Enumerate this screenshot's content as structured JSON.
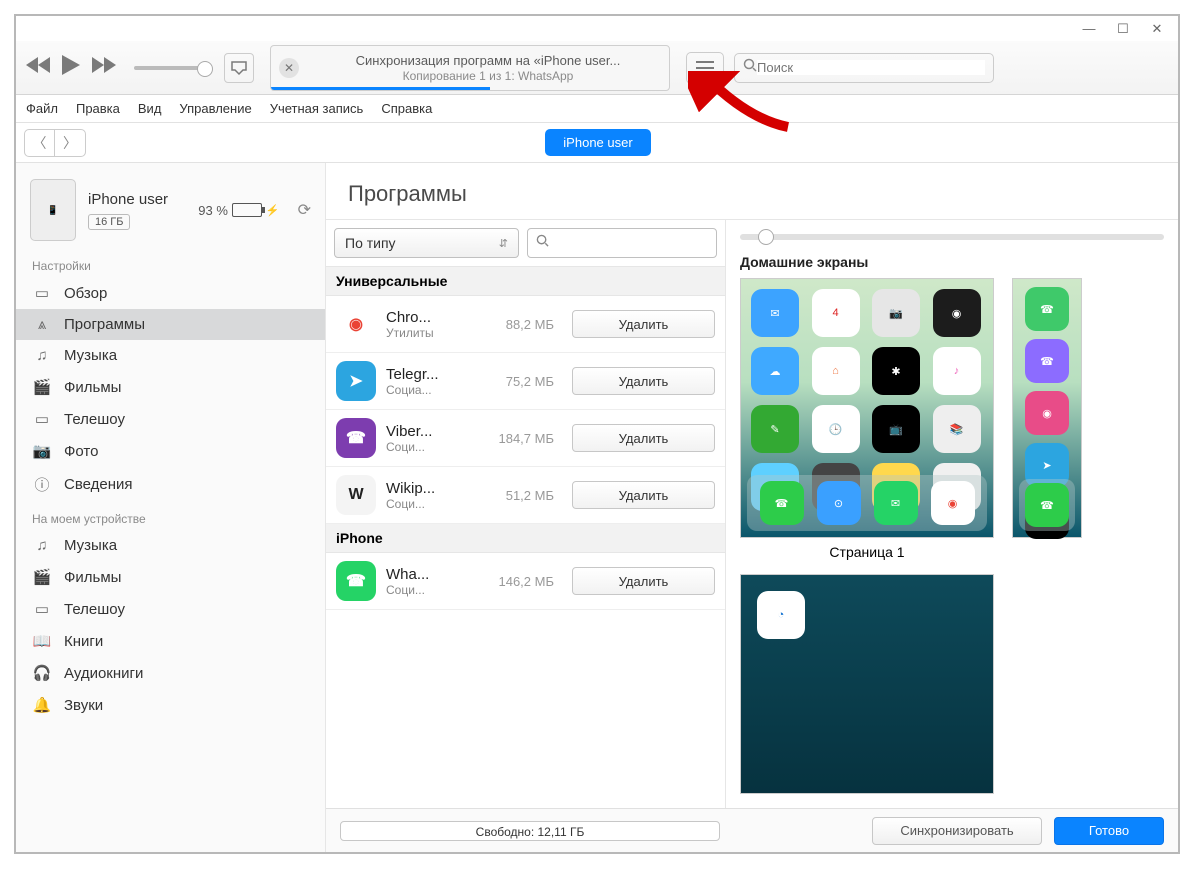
{
  "window": {
    "minimize": "—",
    "maximize": "☐",
    "close": "✕"
  },
  "player": {
    "status_title": "Синхронизация программ на «iPhone user...",
    "status_sub": "Копирование 1 из 1: WhatsApp",
    "search_placeholder": "Поиск"
  },
  "menus": [
    "Файл",
    "Правка",
    "Вид",
    "Управление",
    "Учетная запись",
    "Справка"
  ],
  "device_pill": "iPhone user",
  "device": {
    "name": "iPhone user",
    "capacity_label": "16 ГБ",
    "battery_pct": "93 %"
  },
  "sidebar": {
    "settings_header": "Настройки",
    "settings": [
      {
        "icon": "overview-icon",
        "glyph": "▭",
        "label": "Обзор"
      },
      {
        "icon": "apps-icon",
        "glyph": "⩓",
        "label": "Программы",
        "active": true
      },
      {
        "icon": "music-icon",
        "glyph": "♫",
        "label": "Музыка"
      },
      {
        "icon": "movies-icon",
        "glyph": "🎬",
        "label": "Фильмы"
      },
      {
        "icon": "tv-icon",
        "glyph": "▭",
        "label": "Телешоу"
      },
      {
        "icon": "photo-icon",
        "glyph": "📷",
        "label": "Фото"
      },
      {
        "icon": "info-icon",
        "glyph": "ⓘ",
        "label": "Сведения"
      }
    ],
    "device_header": "На моем устройстве",
    "device_items": [
      {
        "icon": "music-icon",
        "glyph": "♫",
        "label": "Музыка"
      },
      {
        "icon": "movies-icon",
        "glyph": "🎬",
        "label": "Фильмы"
      },
      {
        "icon": "tv-icon",
        "glyph": "▭",
        "label": "Телешоу"
      },
      {
        "icon": "books-icon",
        "glyph": "📖",
        "label": "Книги"
      },
      {
        "icon": "audiobooks-icon",
        "glyph": "🎧",
        "label": "Аудиокниги"
      },
      {
        "icon": "tones-icon",
        "glyph": "🔔",
        "label": "Звуки"
      }
    ]
  },
  "main": {
    "heading": "Программы",
    "sort_label": "По типу",
    "groups": [
      {
        "title": "Универсальные",
        "apps": [
          {
            "name": "Chro...",
            "cat": "Утилиты",
            "size": "88,2 МБ",
            "btn": "Удалить",
            "bg": "#fff",
            "glyph": "◉",
            "fg": "#ea4335"
          },
          {
            "name": "Telegr...",
            "cat": "Социа...",
            "size": "75,2 МБ",
            "btn": "Удалить",
            "bg": "#2ca5e0",
            "glyph": "➤"
          },
          {
            "name": "Viber...",
            "cat": "Соци...",
            "size": "184,7 МБ",
            "btn": "Удалить",
            "bg": "#7d3daf",
            "glyph": "☎"
          },
          {
            "name": "Wikip...",
            "cat": "Соци...",
            "size": "51,2 МБ",
            "btn": "Удалить",
            "bg": "#f4f4f4",
            "glyph": "W",
            "fg": "#222"
          }
        ]
      },
      {
        "title": "iPhone",
        "apps": [
          {
            "name": "Wha...",
            "cat": "Соци...",
            "size": "146,2 МБ",
            "btn": "Удалить",
            "bg": "#25d366",
            "glyph": "☎"
          }
        ]
      }
    ],
    "home_header": "Домашние экраны",
    "page1_label": "Страница 1",
    "home_icons_p1": [
      {
        "bg": "#3ca3ff",
        "g": "✉"
      },
      {
        "bg": "#fff",
        "g": "4",
        "fg": "#d22"
      },
      {
        "bg": "#e6e6e6",
        "g": "📷",
        "fg": "#555"
      },
      {
        "bg": "#1c1c1c",
        "g": "◉"
      },
      {
        "bg": "#3fa9ff",
        "g": "☁"
      },
      {
        "bg": "#fff",
        "g": "⌂",
        "fg": "#e74"
      },
      {
        "bg": "#000",
        "g": "✱"
      },
      {
        "bg": "#fff",
        "g": "♪",
        "fg": "#e6b"
      },
      {
        "bg": "#33a933",
        "g": "✎"
      },
      {
        "bg": "#fff",
        "g": "🕒",
        "fg": "#333"
      },
      {
        "bg": "#000",
        "g": "📺"
      },
      {
        "bg": "#eee",
        "g": "📚",
        "fg": "#e80"
      },
      {
        "bg": "#5ed0ff",
        "g": "Ⓐ"
      },
      {
        "bg": "#444",
        "g": "⚙"
      },
      {
        "bg": "#ffd84d",
        "g": "♥",
        "fg": "#b03"
      },
      {
        "bg": "#f0f0f0",
        "g": "▦",
        "fg": "#555"
      }
    ],
    "dock_icons_p1": [
      {
        "bg": "#2dcc4a",
        "g": "☎"
      },
      {
        "bg": "#3aa0ff",
        "g": "⊙"
      },
      {
        "bg": "#25d366",
        "g": "✉"
      },
      {
        "bg": "#fff",
        "g": "◉",
        "fg": "#ea4335"
      }
    ],
    "home_icons_side": [
      {
        "bg": "#3fc96a",
        "g": "☎"
      },
      {
        "bg": "#8c6cff",
        "g": "☎"
      },
      {
        "bg": "#e84c88",
        "g": "◉"
      },
      {
        "bg": "#2ca5e0",
        "g": "➤"
      },
      {
        "bg": "#000",
        "g": "◯"
      }
    ],
    "dock_icons_side": [
      {
        "bg": "#2dcc4a",
        "g": "☎"
      }
    ],
    "page2_icon": {
      "bg": "#fff",
      "g": "◔",
      "fg": "#1976d2"
    }
  },
  "footer": {
    "free_label": "Свободно: 12,11 ГБ",
    "segments": [
      {
        "c": "#ffb000",
        "w": "2%"
      },
      {
        "c": "#e84cc1",
        "w": "3%"
      },
      {
        "c": "#2ecc40",
        "w": "6%"
      },
      {
        "c": "#ff9500",
        "w": "2%"
      }
    ],
    "sync_btn": "Синхронизировать",
    "done_btn": "Готово"
  }
}
